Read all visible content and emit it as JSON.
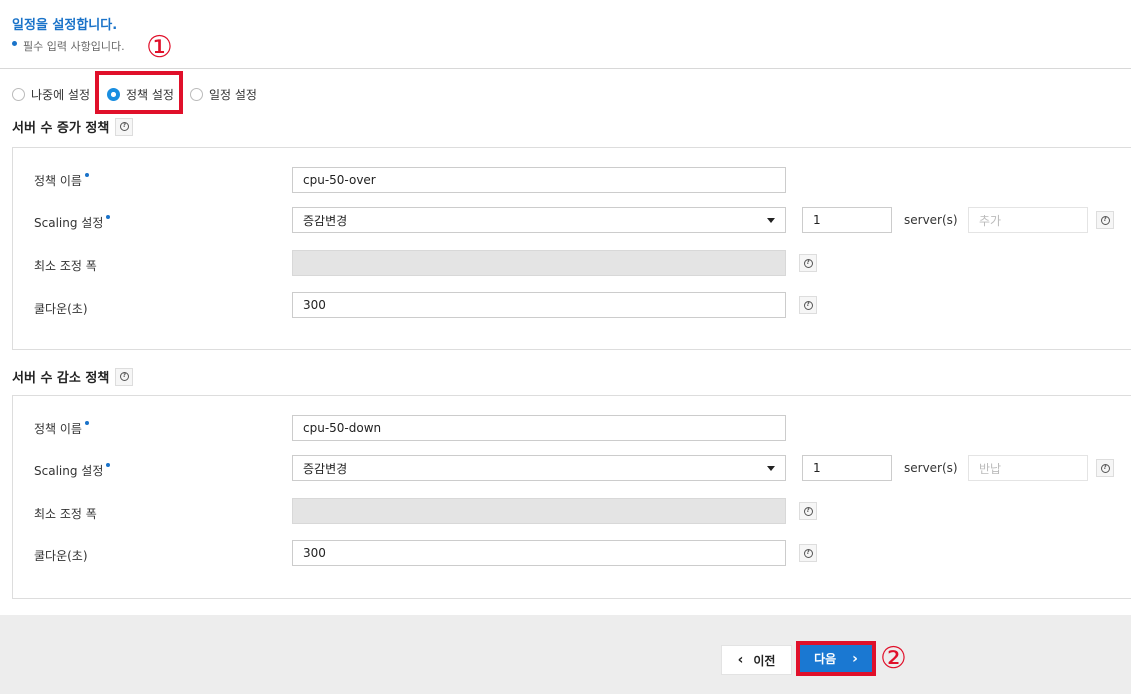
{
  "header": {
    "title": "일정을 설정합니다.",
    "required_note": "필수 입력 사항입니다."
  },
  "annotations": {
    "step1": "①",
    "step2": "②"
  },
  "radios": [
    {
      "label": "나중에 설정",
      "checked": false
    },
    {
      "label": "정책 설정",
      "checked": true
    },
    {
      "label": "일정 설정",
      "checked": false
    }
  ],
  "increase_policy": {
    "section_title": "서버 수 증가 정책",
    "name_label": "정책 이름",
    "name_value": "cpu-50-over",
    "scaling_label": "Scaling 설정",
    "scaling_select": "증감변경",
    "scaling_count": "1",
    "unit": "server(s)",
    "action_placeholder": "추가",
    "min_step_label": "최소 조정 폭",
    "min_step_value": "",
    "cooldown_label": "쿨다운(초)",
    "cooldown_value": "300"
  },
  "decrease_policy": {
    "section_title": "서버 수 감소 정책",
    "name_label": "정책 이름",
    "name_value": "cpu-50-down",
    "scaling_label": "Scaling 설정",
    "scaling_select": "증감변경",
    "scaling_count": "1",
    "unit": "server(s)",
    "action_placeholder": "반납",
    "min_step_label": "최소 조정 폭",
    "min_step_value": "",
    "cooldown_label": "쿨다운(초)",
    "cooldown_value": "300"
  },
  "footer": {
    "prev_label": "이전",
    "next_label": "다음"
  },
  "colors": {
    "accent": "#1a73c9",
    "button_primary": "#1a78d2",
    "annotation_red": "#e0102a"
  }
}
